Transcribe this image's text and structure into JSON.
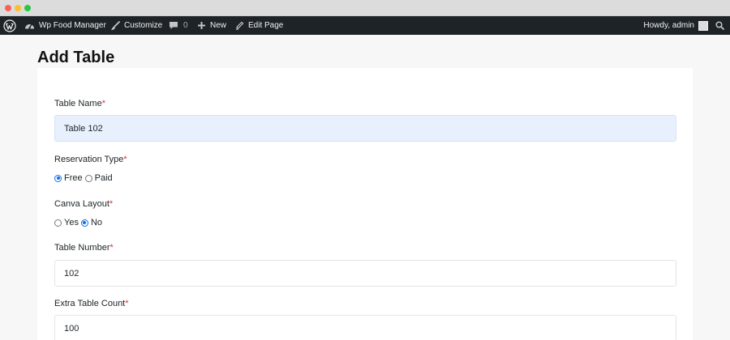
{
  "adminbar": {
    "site_name": "Wp Food Manager",
    "customize": "Customize",
    "comments_count": "0",
    "new": "New",
    "edit_page": "Edit Page",
    "howdy": "Howdy, admin"
  },
  "page": {
    "title": "Add Table"
  },
  "form": {
    "table_name": {
      "label": "Table Name",
      "required": "*",
      "value": "Table 102"
    },
    "reservation_type": {
      "label": "Reservation Type",
      "required": "*",
      "options": [
        {
          "label": "Free",
          "checked": true
        },
        {
          "label": "Paid",
          "checked": false
        }
      ]
    },
    "canva_layout": {
      "label": "Canva Layout",
      "required": "*",
      "options": [
        {
          "label": "Yes",
          "checked": false
        },
        {
          "label": "No",
          "checked": true
        }
      ]
    },
    "table_number": {
      "label": "Table Number",
      "required": "*",
      "value": "102"
    },
    "extra_table_count": {
      "label": "Extra Table Count",
      "required": "*",
      "value": "100"
    }
  },
  "colors": {
    "adminbar_bg": "#1d2327",
    "required": "#d63638",
    "accent": "#0f6fe8",
    "autofill_bg": "#e8f0fe"
  }
}
